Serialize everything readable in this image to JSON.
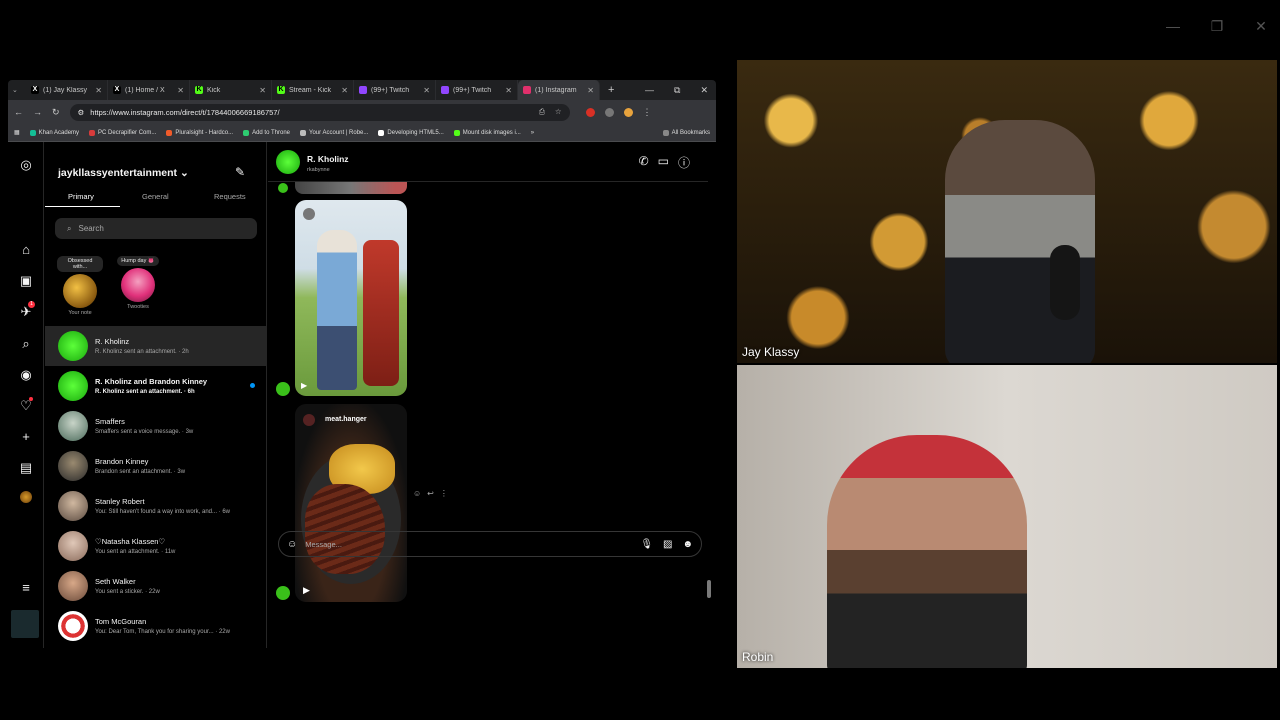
{
  "browser": {
    "tabs": [
      {
        "title": "(1) Jay Klassy",
        "icon": "x-icon",
        "color": "#000000"
      },
      {
        "title": "(1) Home / X",
        "icon": "x-icon",
        "color": "#000000"
      },
      {
        "title": "Kick",
        "icon": "kick-icon",
        "color": "#53fc18"
      },
      {
        "title": "Stream - Kick",
        "icon": "kick-icon",
        "color": "#53fc18"
      },
      {
        "title": "(99+) Twitch",
        "icon": "twitch-icon",
        "color": "#9146ff"
      },
      {
        "title": "(99+) Twitch",
        "icon": "twitch-icon",
        "color": "#9146ff"
      },
      {
        "title": "(1) Instagram",
        "icon": "instagram-icon",
        "color": "#e1306c",
        "active": true
      }
    ],
    "url": "https://www.instagram.com/direct/t/17844006669186757/",
    "bookmarks": [
      {
        "label": "Khan Academy",
        "color": "#14bf96"
      },
      {
        "label": "PC Decrapifier Com...",
        "color": "#d83b3b"
      },
      {
        "label": "Pluralsight - Hardco...",
        "color": "#f15b2a"
      },
      {
        "label": "Add to Throne",
        "color": "#2ecc71"
      },
      {
        "label": "Your Account | Robe...",
        "color": "#bbbbbb"
      },
      {
        "label": "Developing HTML5...",
        "color": "#ffffff"
      },
      {
        "label": "Mount disk images i...",
        "color": "#53fc18"
      }
    ],
    "all_bookmarks": "All Bookmarks"
  },
  "instagram": {
    "account": "jaykllassyentertainment",
    "tabs": {
      "primary": "Primary",
      "general": "General",
      "requests": "Requests"
    },
    "search_placeholder": "Search",
    "notes": [
      {
        "bubble": "Obsessed with...",
        "caption": "Your note"
      },
      {
        "bubble": "Hump day 👅",
        "caption": "Twooties"
      }
    ],
    "conversations": [
      {
        "name": "R. Kholinz",
        "preview": "R. Kholinz sent an attachment. · 2h",
        "selected": true
      },
      {
        "name": "R. Kholinz and Brandon Kinney",
        "preview": "R. Kholinz sent an attachment. · 6h",
        "unread": true
      },
      {
        "name": "Smaffers",
        "preview": "Smaffers sent a voice message. · 3w"
      },
      {
        "name": "Brandon Kinney",
        "preview": "Brandon sent an attachment. · 3w"
      },
      {
        "name": "Stanley Robert",
        "preview": "You: Still haven't found a way into work, and... · 6w"
      },
      {
        "name": "♡Natasha Klassen♡",
        "preview": "You sent an attachment. · 11w"
      },
      {
        "name": "Seth Walker",
        "preview": "You sent a sticker. · 22w"
      },
      {
        "name": "Tom McGouran",
        "preview": "You: Dear Tom, Thank you for sharing your... · 22w"
      }
    ],
    "thread": {
      "name": "R. Kholinz",
      "username": "rkabynne",
      "post_author": "meat.hanger",
      "composer_placeholder": "Message..."
    }
  },
  "video": {
    "top_label": "Jay Klassy",
    "bottom_label": "Robin"
  }
}
